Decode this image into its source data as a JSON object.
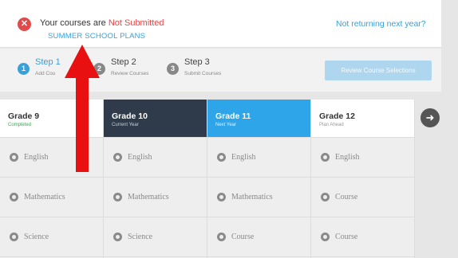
{
  "banner": {
    "status_prefix": "Your courses are ",
    "status_value": "Not Submitted",
    "plan_link": "SUMMER SCHOOL PLANS",
    "not_returning": "Not returning next year?",
    "error_icon": "x-circle-icon"
  },
  "steps": [
    {
      "number": "1",
      "title": "Step 1",
      "subtitle": "Add Cou",
      "color": "#3aa0d8",
      "active": true
    },
    {
      "number": "2",
      "title": "Step 2",
      "subtitle": "Review Courses",
      "color": "#888888",
      "active": false
    },
    {
      "number": "3",
      "title": "Step 3",
      "subtitle": "Submit Courses",
      "color": "#888888",
      "active": false
    }
  ],
  "review_button": "Review Course Selections",
  "grades": [
    {
      "name": "Grade 9",
      "status": "Completed",
      "style": "green-sub",
      "courses": [
        "English",
        "Mathematics",
        "Science"
      ]
    },
    {
      "name": "Grade 10",
      "status": "Current Year",
      "style": "dark",
      "courses": [
        "English",
        "Mathematics",
        "Science"
      ]
    },
    {
      "name": "Grade 11",
      "status": "Next Year",
      "style": "blue",
      "courses": [
        "English",
        "Mathematics",
        "Course"
      ]
    },
    {
      "name": "Grade 12",
      "status": "Plan Ahead",
      "style": "",
      "courses": [
        "English",
        "Course",
        "Course"
      ]
    }
  ],
  "next_button": "arrow-right-icon",
  "colors": {
    "accent": "#3aa0d8",
    "error": "#e04a4a",
    "dark_header": "#2f3b4a",
    "blue_header": "#2ea5e8",
    "arrow": "#e81010"
  }
}
